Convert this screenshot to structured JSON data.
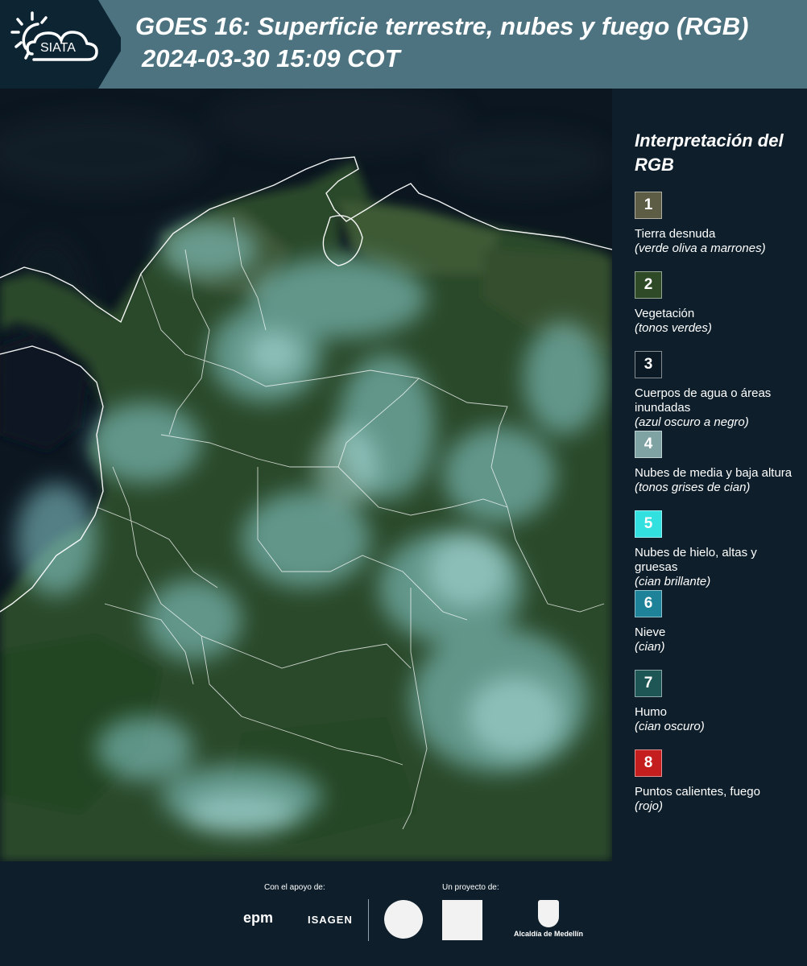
{
  "header": {
    "logo_text": "SIATA",
    "title": "GOES 16: Superficie terrestre, nubes y fuego (RGB)",
    "subtitle": "2024-03-30 15:09 COT"
  },
  "map": {
    "description_icon": "satellite-map-image"
  },
  "legend": {
    "title": "Interpretación del RGB",
    "items": [
      {
        "number": "1",
        "label": "Tierra desnuda",
        "sub": "(verde oliva a marrones)",
        "color": "#5d5d46"
      },
      {
        "number": "2",
        "label": "Vegetación",
        "sub": "(tonos verdes)",
        "color": "#2e4a26"
      },
      {
        "number": "3",
        "label": "Cuerpos de agua o áreas inundadas",
        "sub": "(azul oscuro a negro)",
        "color": "#0b1a24"
      },
      {
        "number": "4",
        "label": "Nubes de media y baja altura",
        "sub": "(tonos grises de cian)",
        "color": "#7fa3a3"
      },
      {
        "number": "5",
        "label": "Nubes de hielo, altas y gruesas",
        "sub": "(cian brillante)",
        "color": "#32e0e0"
      },
      {
        "number": "6",
        "label": "Nieve",
        "sub": "(cian)",
        "color": "#1e8299"
      },
      {
        "number": "7",
        "label": "Humo",
        "sub": "(cian oscuro)",
        "color": "#1e5555"
      },
      {
        "number": "8",
        "label": "Puntos calientes, fuego",
        "sub": "(rojo)",
        "color": "#c41e1e"
      }
    ]
  },
  "footer": {
    "support_label": "Con el apoyo de:",
    "project_label": "Un proyecto de:",
    "epm": "epm",
    "isagen": "ISAGEN",
    "alcaldia": "Alcaldía de Medellín"
  }
}
